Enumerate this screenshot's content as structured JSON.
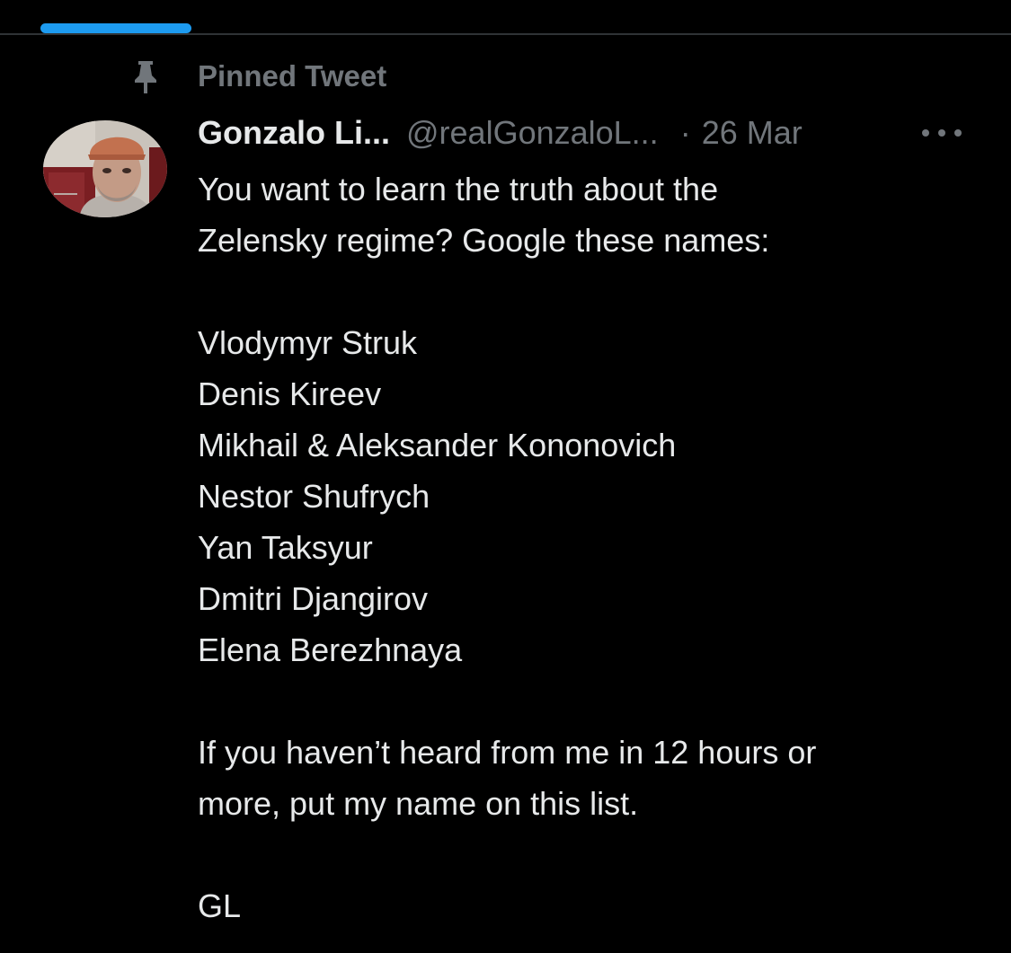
{
  "pinned_label": "Pinned Tweet",
  "author": {
    "display_name": "Gonzalo Li...",
    "handle": "@realGonzaloL...",
    "separator": "·",
    "date": "26 Mar"
  },
  "tweet": {
    "intro": [
      "You want to learn the truth about the",
      "Zelensky regime? Google these names:"
    ],
    "names": [
      "Vlodymyr Struk",
      "Denis Kireev",
      "Mikhail & Aleksander Kononovich",
      "Nestor Shufrych",
      "Yan Taksyur",
      "Dmitri Djangirov",
      "Elena Berezhnaya"
    ],
    "outro": [
      "If you haven’t heard from me in 12 hours or",
      "more, put my name on this list."
    ],
    "signature": "GL"
  },
  "icons": {
    "pin": "pin-icon",
    "more": "more-options-icon",
    "avatar": "avatar"
  },
  "colors": {
    "background": "#000000",
    "primary_text": "#e7e9ea",
    "secondary_text": "#71767b",
    "accent": "#1d9bf0",
    "divider": "#2f3336"
  }
}
